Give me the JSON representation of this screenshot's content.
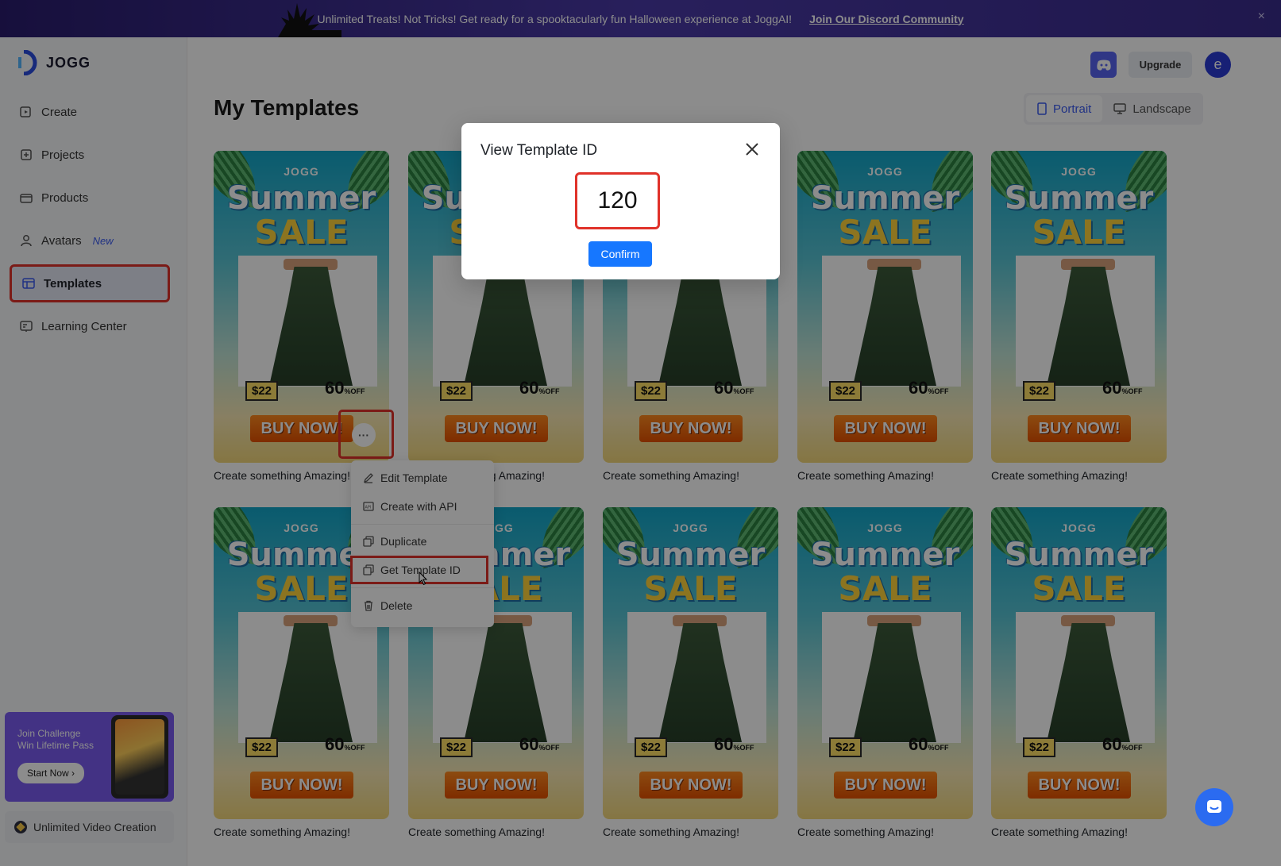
{
  "banner": {
    "message": "Unlimited Treats! Not Tricks! Get ready for a spooktacularly fun Halloween experience at JoggAI!",
    "link": "Join Our Discord Community",
    "close": "×"
  },
  "brand": {
    "name": "JOGG"
  },
  "sidebar": {
    "items": [
      {
        "label": "Create",
        "icon": "create-icon"
      },
      {
        "label": "Projects",
        "icon": "projects-icon"
      },
      {
        "label": "Products",
        "icon": "products-icon"
      },
      {
        "label": "Avatars",
        "icon": "avatar-icon",
        "badge": "New"
      },
      {
        "label": "Templates",
        "icon": "templates-icon",
        "active": true
      },
      {
        "label": "Learning Center",
        "icon": "learning-icon"
      }
    ],
    "promo": {
      "line1": "Join Challenge",
      "line2": "Win Lifetime Pass",
      "button": "Start Now ›"
    },
    "unlimited": "Unlimited Video Creation"
  },
  "header": {
    "upgrade": "Upgrade",
    "avatar_initial": "e"
  },
  "main": {
    "title": "My Templates",
    "orientation": {
      "portrait": "Portrait",
      "landscape": "Landscape",
      "selected": "Portrait"
    }
  },
  "template_card": {
    "brand": "JOGG",
    "headline1": "Summer",
    "headline2": "SALE",
    "price": "$22",
    "discount": "60",
    "discount_suffix": "%",
    "discount_off": "OFF",
    "cta": "BUY NOW!",
    "caption": "Create something Amazing!"
  },
  "more_button": "···",
  "context_menu": {
    "items": [
      {
        "label": "Edit Template",
        "icon": "edit-icon"
      },
      {
        "label": "Create with API",
        "icon": "api-icon"
      },
      {
        "label": "Duplicate",
        "icon": "duplicate-icon"
      },
      {
        "label": "Get Template ID",
        "icon": "copy-icon",
        "highlighted": true
      },
      {
        "label": "Delete",
        "icon": "trash-icon"
      }
    ]
  },
  "modal": {
    "title": "View Template ID",
    "template_id": "120",
    "confirm": "Confirm"
  },
  "colors": {
    "accent": "#1677ff",
    "highlight": "#e0322a",
    "banner": "#3a2c8c",
    "discord": "#5865f2",
    "avatar": "#2b3bd6"
  }
}
